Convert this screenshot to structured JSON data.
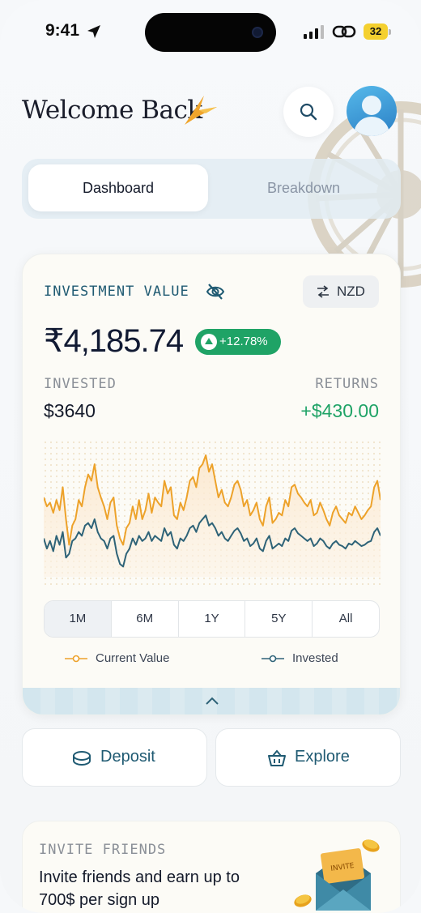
{
  "status_bar": {
    "time": "9:41",
    "battery": "32"
  },
  "header": {
    "title": "Welcome Back"
  },
  "tabs": [
    {
      "label": "Dashboard",
      "active": true
    },
    {
      "label": "Breakdown",
      "active": false
    }
  ],
  "investment": {
    "label": "INVESTMENT VALUE",
    "currency": "NZD",
    "value": "₹4,185.74",
    "change": "+12.78%",
    "invested_label": "INVESTED",
    "invested_value": "$3640",
    "returns_label": "RETURNS",
    "returns_value": "+$430.00"
  },
  "periods": [
    "1M",
    "6M",
    "1Y",
    "5Y",
    "All"
  ],
  "active_period": "1M",
  "legend": {
    "current": "Current Value",
    "invested": "Invested"
  },
  "colors": {
    "current": "#eda22a",
    "invested": "#2e6378",
    "accent": "#1f5a72",
    "positive": "#1fa366"
  },
  "chart_data": {
    "type": "line",
    "x": [
      1,
      2,
      3,
      4,
      5,
      6,
      7,
      8,
      9,
      10,
      11,
      12,
      13,
      14,
      15,
      16,
      17,
      18,
      19,
      20,
      21,
      22,
      23,
      24,
      25,
      26,
      27,
      28,
      29,
      30,
      31,
      32,
      33,
      34,
      35,
      36,
      37,
      38,
      39,
      40,
      41,
      42,
      43,
      44,
      45,
      46,
      47,
      48,
      49,
      50,
      51,
      52,
      53,
      54,
      55,
      56,
      57,
      58,
      59,
      60
    ],
    "series": [
      {
        "name": "Current Value",
        "values": [
          62,
          55,
          58,
          50,
          60,
          52,
          70,
          45,
          25,
          40,
          45,
          60,
          55,
          70,
          80,
          75,
          88,
          70,
          62,
          55,
          45,
          58,
          62,
          40,
          30,
          25,
          38,
          42,
          55,
          45,
          60,
          45,
          52,
          65,
          50,
          62,
          58,
          55,
          75,
          65,
          70,
          48,
          45,
          58,
          52,
          62,
          75,
          78,
          70,
          85,
          88,
          95,
          82,
          88,
          75,
          62,
          68,
          58,
          55,
          62,
          72,
          75,
          68,
          55,
          60,
          48,
          52,
          58,
          45,
          40,
          55,
          62,
          42,
          45,
          50,
          48,
          60,
          55,
          70,
          72,
          65,
          62,
          58,
          55,
          60,
          48,
          50,
          58,
          52,
          45,
          40,
          50,
          55,
          48,
          45,
          42,
          50,
          48,
          55,
          50,
          45,
          48,
          52,
          55,
          70,
          75,
          60
        ]
      },
      {
        "name": "Invested",
        "values": [
          30,
          22,
          28,
          20,
          32,
          25,
          35,
          15,
          18,
          28,
          30,
          35,
          32,
          40,
          42,
          38,
          45,
          35,
          30,
          28,
          22,
          30,
          32,
          18,
          10,
          8,
          18,
          22,
          30,
          25,
          32,
          28,
          30,
          35,
          28,
          32,
          30,
          28,
          38,
          32,
          35,
          25,
          22,
          30,
          28,
          32,
          38,
          40,
          35,
          42,
          45,
          48,
          40,
          42,
          38,
          32,
          35,
          30,
          28,
          32,
          36,
          38,
          34,
          28,
          30,
          24,
          26,
          30,
          22,
          20,
          28,
          32,
          22,
          24,
          26,
          24,
          30,
          28,
          36,
          38,
          34,
          32,
          30,
          28,
          30,
          24,
          26,
          30,
          28,
          24,
          22,
          26,
          28,
          25,
          24,
          22,
          26,
          25,
          28,
          26,
          24,
          25,
          27,
          28,
          35,
          38,
          32
        ]
      }
    ]
  },
  "actions": {
    "deposit": "Deposit",
    "explore": "Explore"
  },
  "invite": {
    "title": "INVITE FRIENDS",
    "text": "Invite friends and earn  up to 700$ per sign up",
    "badge": "INVITE"
  }
}
